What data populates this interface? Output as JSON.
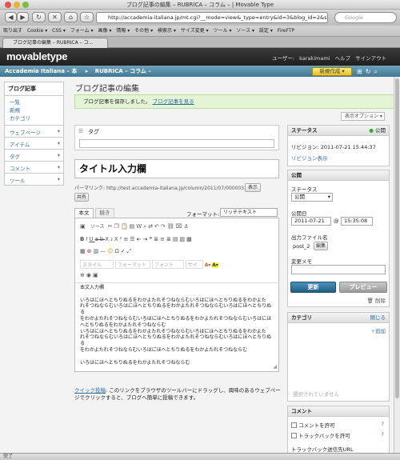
{
  "window": {
    "title": "ブログ記事の編集 – RUBRICA – コラム – | Movable Type"
  },
  "browser": {
    "url": "http://accademia-italiana.jp/mt.cgi?__mode=view&_type=entry&id=3&blog_id=2&saved",
    "search_placeholder": "Google",
    "bookmarks": [
      "取り出す",
      "Cookie ▾",
      "CSS ▾",
      "フォーム ▾",
      "画像 ▾",
      "情報 ▾",
      "その他 ▾",
      "検索示 ▾",
      "サイズ変更 ▾",
      "ツール ▾",
      "ソース ▾",
      "設定 ▾",
      "FireFTP"
    ],
    "tab_title": "ブログ記事の編集 – RUBRICA – コ..."
  },
  "mt": {
    "logo": "movabletype",
    "user_label": "ユーザー:",
    "username": "karakimami",
    "help": "ヘルプ",
    "signout": "サインアウト",
    "blog_name": "Accademia Italiana – 本",
    "site_name": "RUBRICA – コラム –",
    "new_button": "新規作成 ▾"
  },
  "sidebar": {
    "entries_header": "ブログ記事",
    "entries_items": [
      "一覧",
      "新規",
      "カテゴリ"
    ],
    "sections": [
      "ウェブページ",
      "アイテム",
      "タグ",
      "コメント",
      "ツール"
    ]
  },
  "page": {
    "title": "ブログ記事の編集",
    "message": "ブログ記事を保存しました。",
    "message_link": "ブログ記事を見る",
    "display_options": "表示オプション ▾",
    "tag_label": "タグ",
    "entry_title": "タイトル入力欄",
    "permalink_label": "パーマリンク:",
    "permalink_url": "http://test.accademia-italiana.jp/column/2011/07/000003.html",
    "view_button": "表示",
    "share_button": "共有",
    "tab_body": "本文",
    "tab_more": "続き",
    "format_label": "フォーマット:",
    "format_value": "リッチテキスト",
    "toolbar_source": "ソース",
    "toolbar_style": "スタイル",
    "toolbar_format": "フォーマット",
    "toolbar_font": "フォント",
    "toolbar_size": "サイ",
    "body_lines": [
      "本文入力欄",
      "",
      "いろはにほへとちりぬるをわかよたれそつねならむいろはにほへとちりぬるをわかよた",
      "れそつねならむいろはにほへとちりぬるをわかよたれそつねならむいろはにほへとちりぬる",
      "をわかよたれそつねならむいろはにほへとちりぬるをわかよたれそつねならむいろはにほ",
      "へとちりぬるをわかよたれそつねならむ",
      "いろはにほへとちりぬるをわかよたれそつねならむいろはにほへとちりぬるをわかよた",
      "れそつねならむいろはにほへとちりぬるをわかよたれそつねならむいろはにほへとちりぬる",
      "をわかよたれそつねならむいろはにほへとちりぬるをわかよたれそつねならむ",
      "",
      "いろはにほへとちりぬるをわかよたれそつねならむ"
    ],
    "quickpost_link": "クイック投稿",
    "quickpost_text": ": このリンクをブラウザのツールバーにドラッグし、興味のあるウェブページでクリックすると、ブログへ簡単に投稿できます。"
  },
  "status_panel": {
    "header": "ステータス",
    "status": "公開",
    "revision": "リビジョン: 2011-07-21 15:44:37",
    "revision_link": "リビジョン表示"
  },
  "publish_panel": {
    "header": "公開",
    "status_label": "ステータス",
    "status_value": "公開",
    "date_label": "公開日",
    "date_value": "2011-07-21",
    "time_value": "15:35:08",
    "filename_label": "出力ファイル名",
    "filename_value": "post_2",
    "edit_button": "編集",
    "memo_label": "変更メモ",
    "update_button": "更新",
    "preview_button": "プレビュー",
    "delete_link": "削除"
  },
  "category_panel": {
    "header": "カテゴリ",
    "close_link": "閉じる",
    "add_link": "追加",
    "empty": "選択されていません"
  },
  "comment_panel": {
    "header": "コメント",
    "allow_comments": "コメントを許可",
    "allow_trackbacks": "トラックバックを許可",
    "trackback_url": "トラックバック送信先URL"
  },
  "statusbar": {
    "text": "完了"
  }
}
